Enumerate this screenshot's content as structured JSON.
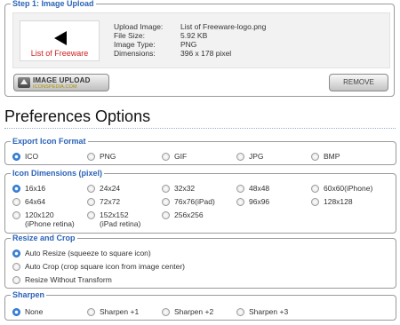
{
  "step1": {
    "legend": "Step 1: Image Upload",
    "thumbnail_text": "List of Freeware",
    "info": [
      {
        "label": "Upload Image:",
        "value": "List of Freeware-logo.png"
      },
      {
        "label": "File Size:",
        "value": "5.92 KB"
      },
      {
        "label": "Image Type:",
        "value": "PNG"
      },
      {
        "label": "Dimensions:",
        "value": "396 x 178 pixel"
      }
    ],
    "upload_button": "IMAGE UPLOAD",
    "upload_button_sub": "ICONSPEDIA.COM",
    "remove_button": "REMOVE"
  },
  "heading": "Preferences Options",
  "export": {
    "legend": "Export Icon Format",
    "options": [
      {
        "label": "ICO",
        "checked": true
      },
      {
        "label": "PNG",
        "checked": false
      },
      {
        "label": "GIF",
        "checked": false
      },
      {
        "label": "JPG",
        "checked": false
      },
      {
        "label": "BMP",
        "checked": false
      }
    ]
  },
  "dimensions": {
    "legend": "Icon Dimensions (pixel)",
    "options": [
      {
        "label": "16x16",
        "checked": true
      },
      {
        "label": "24x24",
        "checked": false
      },
      {
        "label": "32x32",
        "checked": false
      },
      {
        "label": "48x48",
        "checked": false
      },
      {
        "label": "60x60(iPhone)",
        "checked": false
      },
      {
        "label": "64x64",
        "checked": false
      },
      {
        "label": "72x72",
        "checked": false
      },
      {
        "label": "76x76(iPad)",
        "checked": false
      },
      {
        "label": "96x96",
        "checked": false
      },
      {
        "label": "128x128",
        "checked": false
      },
      {
        "label": "120x120",
        "sub": "(iPhone retina)",
        "checked": false
      },
      {
        "label": "152x152",
        "sub": "(iPad retina)",
        "checked": false
      },
      {
        "label": "256x256",
        "checked": false
      }
    ]
  },
  "resize": {
    "legend": "Resize and Crop",
    "options": [
      {
        "label": "Auto Resize (squeeze to square icon)",
        "checked": true
      },
      {
        "label": "Auto Crop (crop square icon from image center)",
        "checked": false
      },
      {
        "label": "Resize Without Transform",
        "checked": false
      }
    ]
  },
  "sharpen": {
    "legend": "Sharpen",
    "options": [
      {
        "label": "None",
        "checked": true
      },
      {
        "label": "Sharpen +1",
        "checked": false
      },
      {
        "label": "Sharpen +2",
        "checked": false
      },
      {
        "label": "Sharpen +3",
        "checked": false
      }
    ]
  }
}
